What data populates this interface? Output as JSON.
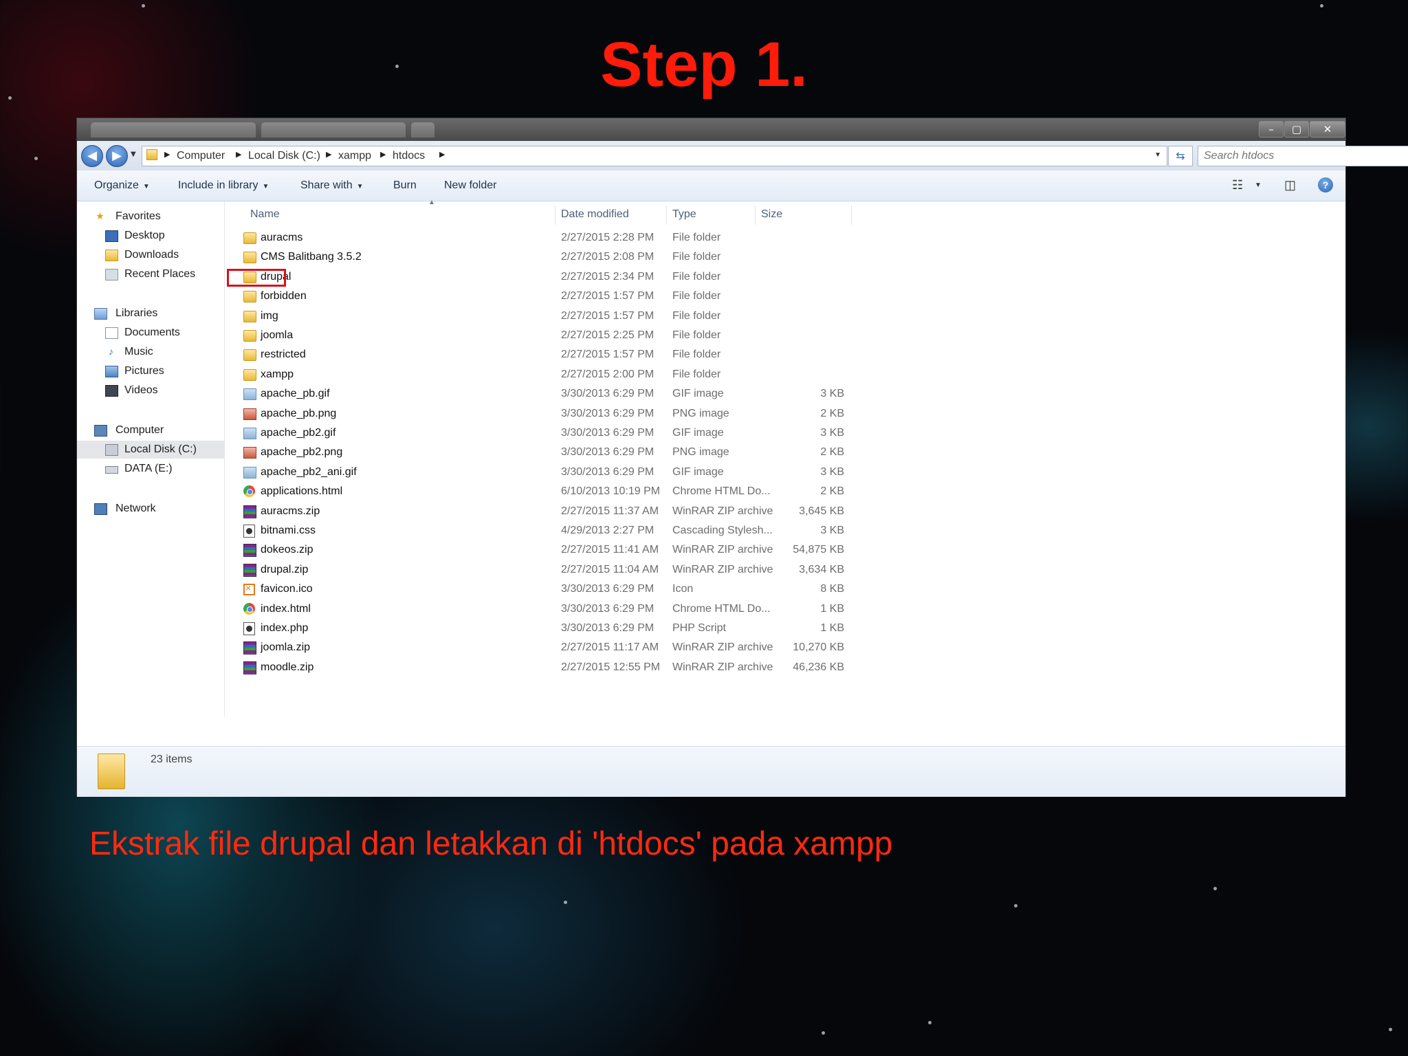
{
  "slide": {
    "title": "Step 1.",
    "caption": "Ekstrak file drupal dan letakkan di 'htdocs' pada xampp"
  },
  "window": {
    "controls": {
      "minimize": "–",
      "maximize": "▢",
      "close": "✕"
    },
    "address": {
      "back_icon": "back-arrow-icon",
      "forward_icon": "forward-arrow-icon",
      "crumbs": [
        "Computer",
        "Local Disk (C:)",
        "xampp",
        "htdocs"
      ]
    },
    "search": {
      "placeholder": "Search htdocs"
    },
    "toolbar": {
      "organize": "Organize",
      "include": "Include in library",
      "share": "Share with",
      "burn": "Burn",
      "new_folder": "New folder"
    },
    "nav": {
      "favorites": "Favorites",
      "desktop": "Desktop",
      "downloads": "Downloads",
      "recent": "Recent Places",
      "libraries": "Libraries",
      "documents": "Documents",
      "music": "Music",
      "pictures": "Pictures",
      "videos": "Videos",
      "computer": "Computer",
      "local_disk": "Local Disk (C:)",
      "data_disk": "DATA (E:)",
      "network": "Network"
    },
    "columns": {
      "name": "Name",
      "date": "Date modified",
      "type": "Type",
      "size": "Size"
    },
    "files": [
      {
        "name": "auracms",
        "date": "2/27/2015 2:28 PM",
        "type": "File folder",
        "size": "",
        "icon": "folder"
      },
      {
        "name": "CMS Balitbang 3.5.2",
        "date": "2/27/2015 2:08 PM",
        "type": "File folder",
        "size": "",
        "icon": "folder"
      },
      {
        "name": "drupal",
        "date": "2/27/2015 2:34 PM",
        "type": "File folder",
        "size": "",
        "icon": "folder"
      },
      {
        "name": "forbidden",
        "date": "2/27/2015 1:57 PM",
        "type": "File folder",
        "size": "",
        "icon": "folder"
      },
      {
        "name": "img",
        "date": "2/27/2015 1:57 PM",
        "type": "File folder",
        "size": "",
        "icon": "folder"
      },
      {
        "name": "joomla",
        "date": "2/27/2015 2:25 PM",
        "type": "File folder",
        "size": "",
        "icon": "folder"
      },
      {
        "name": "restricted",
        "date": "2/27/2015 1:57 PM",
        "type": "File folder",
        "size": "",
        "icon": "folder"
      },
      {
        "name": "xampp",
        "date": "2/27/2015 2:00 PM",
        "type": "File folder",
        "size": "",
        "icon": "folder"
      },
      {
        "name": "apache_pb.gif",
        "date": "3/30/2013 6:29 PM",
        "type": "GIF image",
        "size": "3 KB",
        "icon": "gif"
      },
      {
        "name": "apache_pb.png",
        "date": "3/30/2013 6:29 PM",
        "type": "PNG image",
        "size": "2 KB",
        "icon": "png"
      },
      {
        "name": "apache_pb2.gif",
        "date": "3/30/2013 6:29 PM",
        "type": "GIF image",
        "size": "3 KB",
        "icon": "gif"
      },
      {
        "name": "apache_pb2.png",
        "date": "3/30/2013 6:29 PM",
        "type": "PNG image",
        "size": "2 KB",
        "icon": "png"
      },
      {
        "name": "apache_pb2_ani.gif",
        "date": "3/30/2013 6:29 PM",
        "type": "GIF image",
        "size": "3 KB",
        "icon": "gif"
      },
      {
        "name": "applications.html",
        "date": "6/10/2013 10:19 PM",
        "type": "Chrome HTML Do...",
        "size": "2 KB",
        "icon": "chrome"
      },
      {
        "name": "auracms.zip",
        "date": "2/27/2015 11:37 AM",
        "type": "WinRAR ZIP archive",
        "size": "3,645 KB",
        "icon": "zip"
      },
      {
        "name": "bitnami.css",
        "date": "4/29/2013 2:27 PM",
        "type": "Cascading Stylesh...",
        "size": "3 KB",
        "icon": "script"
      },
      {
        "name": "dokeos.zip",
        "date": "2/27/2015 11:41 AM",
        "type": "WinRAR ZIP archive",
        "size": "54,875 KB",
        "icon": "zip"
      },
      {
        "name": "drupal.zip",
        "date": "2/27/2015 11:04 AM",
        "type": "WinRAR ZIP archive",
        "size": "3,634 KB",
        "icon": "zip"
      },
      {
        "name": "favicon.ico",
        "date": "3/30/2013 6:29 PM",
        "type": "Icon",
        "size": "8 KB",
        "icon": "ico"
      },
      {
        "name": "index.html",
        "date": "3/30/2013 6:29 PM",
        "type": "Chrome HTML Do...",
        "size": "1 KB",
        "icon": "chrome"
      },
      {
        "name": "index.php",
        "date": "3/30/2013 6:29 PM",
        "type": "PHP Script",
        "size": "1 KB",
        "icon": "script"
      },
      {
        "name": "joomla.zip",
        "date": "2/27/2015 11:17 AM",
        "type": "WinRAR ZIP archive",
        "size": "10,270 KB",
        "icon": "zip"
      },
      {
        "name": "moodle.zip",
        "date": "2/27/2015 12:55 PM",
        "type": "WinRAR ZIP archive",
        "size": "46,236 KB",
        "icon": "zip"
      }
    ],
    "highlighted_file": "drupal",
    "status": {
      "count": "23 items"
    }
  },
  "colors": {
    "title_red": "#ff1c0a",
    "highlight_red": "#d6121a"
  }
}
